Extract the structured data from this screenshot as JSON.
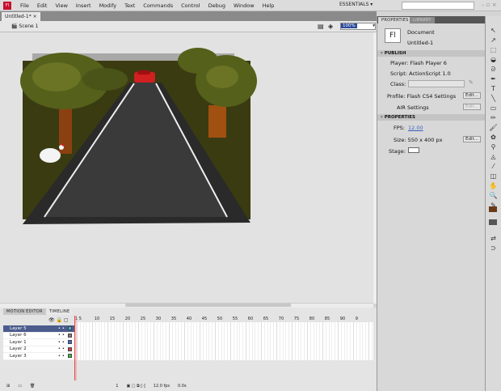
{
  "menubar": {
    "items": [
      "File",
      "Edit",
      "View",
      "Insert",
      "Modify",
      "Text",
      "Commands",
      "Control",
      "Debug",
      "Window",
      "Help"
    ],
    "workspace": "ESSENTIALS",
    "logo": "Fl"
  },
  "document": {
    "tab": "Untitled-1*",
    "close": "×",
    "scene": "Scene 1",
    "zoom": "100%"
  },
  "timeline": {
    "tabs": [
      "MOTION EDITOR",
      "TIMELINE"
    ],
    "layers": [
      {
        "name": "Layer 5",
        "color": "#3fb8c8",
        "selected": true
      },
      {
        "name": "Layer 6",
        "color": "#808080"
      },
      {
        "name": "Layer 1",
        "color": "#3a6ed8"
      },
      {
        "name": "Layer 2",
        "color": "#d04040"
      },
      {
        "name": "Layer 3",
        "color": "#30c040"
      }
    ],
    "ruler": [
      "1",
      "5",
      "10",
      "15",
      "20",
      "25",
      "30",
      "35",
      "40",
      "45",
      "50",
      "55",
      "60",
      "65",
      "70",
      "75",
      "80",
      "85",
      "90",
      "9"
    ],
    "footer": {
      "frame": "1",
      "fps": "12.0 fps",
      "time": "0.0s"
    }
  },
  "properties": {
    "tabs": [
      "PROPERTIES",
      "LIBRARY"
    ],
    "doc_icon": "Fl",
    "doc_type": "Document",
    "doc_name": "Untitled-1",
    "publish_header": "PUBLISH",
    "player": "Player: Flash Player 6",
    "script": "Script: ActionScript 1.0",
    "class_label": "Class:",
    "profile": "Profile: Flash CS4 Settings",
    "air": "AIR Settings",
    "edit": "Edit...",
    "props_header": "PROPERTIES",
    "fps_label": "FPS:",
    "fps": "12.00",
    "size": "Size: 550 x 400 px",
    "stage_label": "Stage:",
    "stage_color": "#ffffff"
  }
}
